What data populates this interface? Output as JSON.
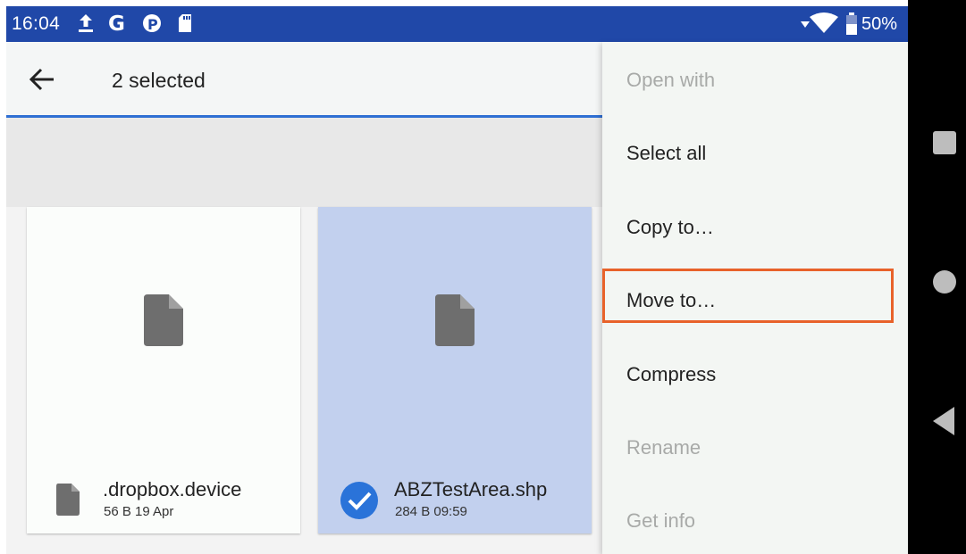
{
  "status_bar": {
    "time": "16:04",
    "battery": "50%",
    "icons": [
      "upload-icon",
      "google-icon",
      "p-app-icon",
      "sd-card-icon",
      "signal-icon",
      "wifi-icon",
      "battery-icon"
    ]
  },
  "app_bar": {
    "title": "2 selected",
    "back_icon": "arrow-back-icon"
  },
  "files": [
    {
      "name": ".dropbox.device",
      "meta": "56 B 19 Apr",
      "selected": false
    },
    {
      "name": "ABZTestArea.shp",
      "meta": "284 B 09:59",
      "selected": true
    }
  ],
  "menu": {
    "items": [
      {
        "label": "Open with",
        "enabled": false
      },
      {
        "label": "Select all",
        "enabled": true
      },
      {
        "label": "Copy to…",
        "enabled": true
      },
      {
        "label": "Move to…",
        "enabled": true,
        "highlighted": true
      },
      {
        "label": "Compress",
        "enabled": true
      },
      {
        "label": "Rename",
        "enabled": false
      },
      {
        "label": "Get info",
        "enabled": false
      }
    ]
  },
  "nav_bar": [
    "recents-icon",
    "home-icon",
    "back-icon"
  ],
  "colors": {
    "status_bar": "#2048a8",
    "accent": "#2f6fd3",
    "selected_card": "#c2d0ee",
    "highlight": "#e8622a",
    "check": "#2a73d9"
  }
}
